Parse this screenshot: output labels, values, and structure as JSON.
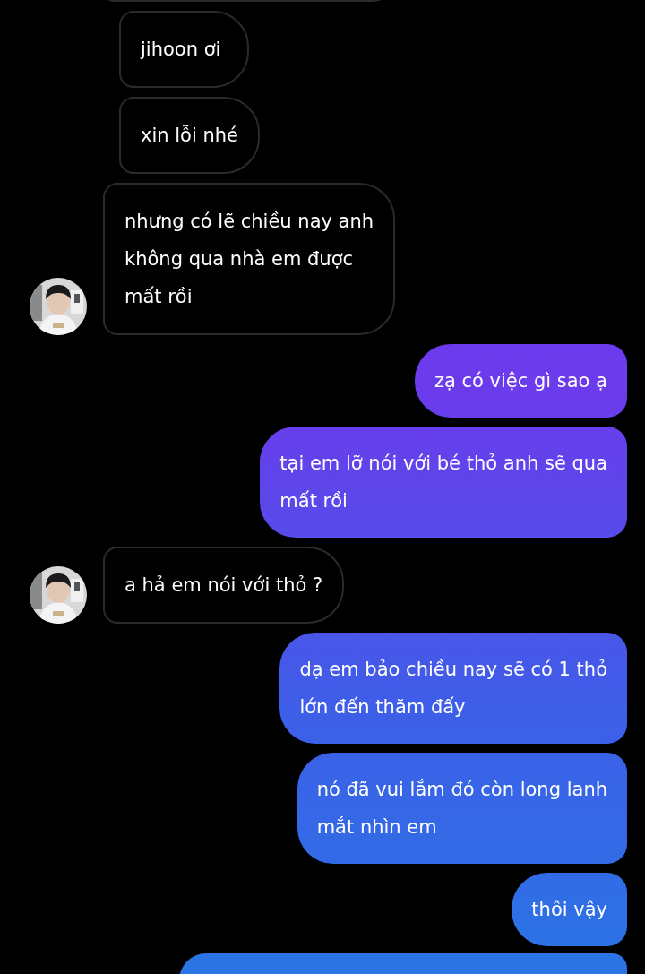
{
  "messages": [
    {
      "kind": "incoming",
      "text": "jihoon ơi",
      "avatar": false
    },
    {
      "kind": "incoming",
      "text": "xin lỗi nhé",
      "avatar": false
    },
    {
      "kind": "incoming",
      "text": "nhưng có lẽ chiều nay anh\nkhông qua nhà em được\nmất rồi",
      "avatar": true
    },
    {
      "kind": "outgoing",
      "text": "zạ có việc gì sao ạ"
    },
    {
      "kind": "outgoing",
      "text": "tại em lỡ nói với bé thỏ anh sẽ qua\nmất rồi"
    },
    {
      "kind": "incoming",
      "text": "a hả em nói với thỏ ?",
      "avatar": true
    },
    {
      "kind": "outgoing",
      "text": "dạ em bảo chiều nay sẽ có 1 thỏ\nlớn đến thăm đấy"
    },
    {
      "kind": "outgoing",
      "text": "nó đã vui lắm đó còn long lanh\nmắt nhìn em"
    },
    {
      "kind": "outgoing",
      "text": "thôi vậy"
    }
  ]
}
